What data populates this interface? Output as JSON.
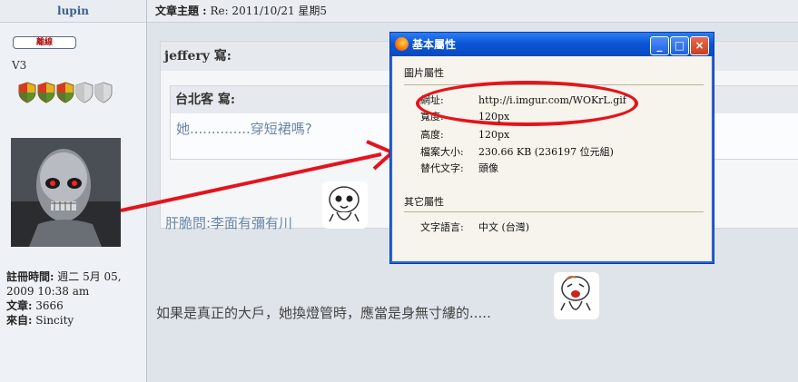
{
  "left_header": {
    "username": "lupin"
  },
  "topic": {
    "label": "文章主題 :",
    "value": "Re: 2011/10/21 星期5"
  },
  "user": {
    "status_badge": "離線",
    "rank": "V3",
    "shields_total": 5,
    "shields_active": 3,
    "info": [
      {
        "key": "註冊時間:",
        "value": "週二 5月 05, 2009 10:38 am"
      },
      {
        "key": "文章:",
        "value": "3666"
      },
      {
        "key": "來自:",
        "value": "Sincity"
      }
    ]
  },
  "post": {
    "outer_quote": {
      "author": "jeffery 寫:",
      "text": "肝脆問:李面有彌有川"
    },
    "inner_quote": {
      "author": "台北客 寫:",
      "text": "她..............穿短裙嗎?"
    },
    "body_text": "如果是真正的大戶，她換燈管時，應當是身無寸縷的....."
  },
  "dialog": {
    "title": "基本屬性",
    "section_image": "圖片屬性",
    "props": [
      {
        "key": "網址:",
        "value": "http://i.imgur.com/WOKrL.gif"
      },
      {
        "key": "寬度:",
        "value": "120px"
      },
      {
        "key": "高度:",
        "value": "120px"
      },
      {
        "key": "檔案大小:",
        "value": "230.66 KB (236197 位元組)"
      },
      {
        "key": "替代文字:",
        "value": "頭像"
      }
    ],
    "section_other": "其它屬性",
    "language": {
      "key": "文字語言:",
      "value": "中文 (台灣)"
    },
    "buttons": {
      "minimize": "_",
      "maximize": "□",
      "close": "×"
    }
  },
  "colors": {
    "annotation_red": "#e4141c",
    "title_blue": "#0b56d6",
    "quote_text": "#6a86a8"
  }
}
